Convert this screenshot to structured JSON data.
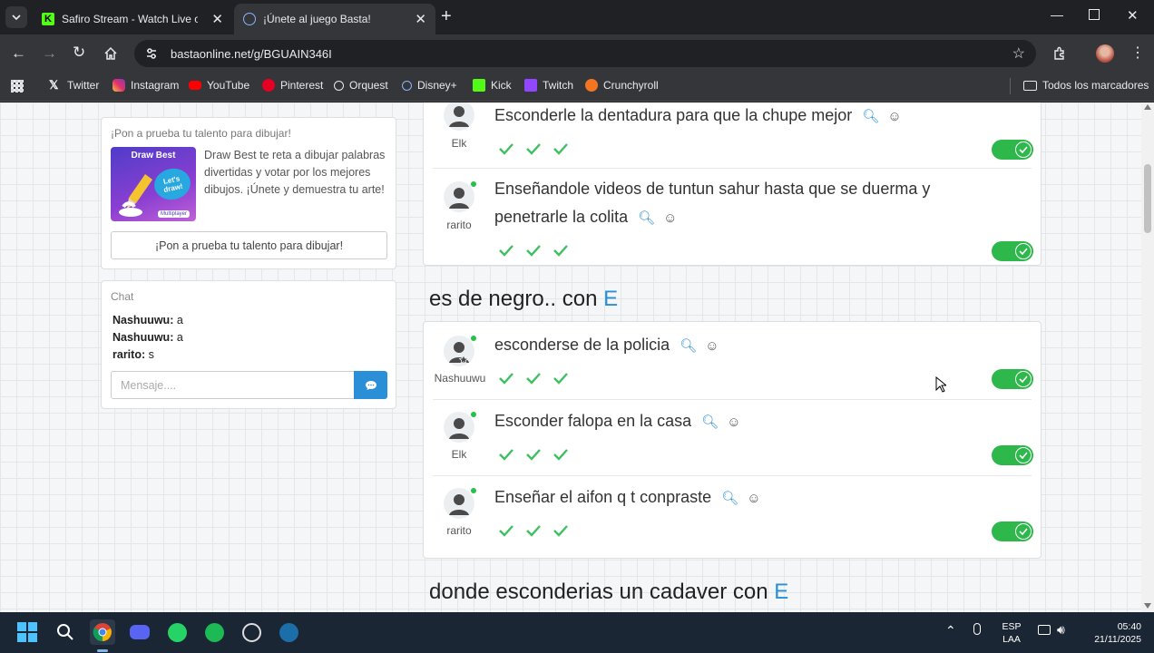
{
  "browser": {
    "tabs": [
      {
        "title": "Safiro Stream - Watch Live on K",
        "icon": "kick-icon",
        "active": false
      },
      {
        "title": "¡Únete al juego Basta!",
        "icon": "globe-icon",
        "active": true
      }
    ],
    "url": "bastaonline.net/g/BGUAIN346I",
    "bookmarks": [
      {
        "label": "Twitter",
        "icon": "x-icon"
      },
      {
        "label": "Instagram",
        "icon": "instagram-icon"
      },
      {
        "label": "YouTube",
        "icon": "youtube-icon"
      },
      {
        "label": "Pinterest",
        "icon": "pinterest-icon"
      },
      {
        "label": "Orquest",
        "icon": "orquest-icon"
      },
      {
        "label": "Disney+",
        "icon": "disney-icon"
      },
      {
        "label": "Kick",
        "icon": "kick-icon"
      },
      {
        "label": "Twitch",
        "icon": "twitch-icon"
      },
      {
        "label": "Crunchyroll",
        "icon": "crunchyroll-icon"
      }
    ],
    "all_bookmarks": "Todos los marcadores"
  },
  "promo": {
    "title": "¡Pon a prueba tu talento para dibujar!",
    "image_title": "Draw Best",
    "image_badge": "Let's draw!",
    "image_tag": "Multiplayer",
    "text": "Draw Best te reta a dibujar palabras divertidas y votar por los mejores dibujos. ¡Únete y demuestra tu arte!",
    "button": "¡Pon a prueba tu talento para dibujar!"
  },
  "chat": {
    "title": "Chat",
    "messages": [
      {
        "user": "Nashuuwu:",
        "text": "a"
      },
      {
        "user": "Nashuuwu:",
        "text": "a"
      },
      {
        "user": "rarito:",
        "text": "s"
      }
    ],
    "placeholder": "Mensaje...."
  },
  "sections": [
    {
      "question": "",
      "letter": "",
      "answers": [
        {
          "user": "Elk",
          "text": "Esconderle la dentadura para que la chupe mejor"
        },
        {
          "user": "rarito",
          "text": "Enseñandole videos de tuntun sahur hasta que se duerma y",
          "text2": "penetrarle la colita"
        }
      ]
    },
    {
      "question": "es de negro.. con",
      "letter": "E",
      "answers": [
        {
          "user": "Nashuuwu",
          "text": "esconderse de la policia"
        },
        {
          "user": "Elk",
          "text": "Esconder falopa en la casa"
        },
        {
          "user": "rarito",
          "text": "Enseñar el aifon q t conpraste"
        }
      ]
    },
    {
      "question": "donde esconderias un cadaver con",
      "letter": "E"
    }
  ],
  "taskbar": {
    "lang1": "ESP",
    "lang2": "LAA",
    "time": "05:40",
    "date": "21/11/2025"
  },
  "colors": {
    "accent": "#2b8fd8",
    "toggle": "#2eb84c",
    "check": "#3cc060"
  }
}
